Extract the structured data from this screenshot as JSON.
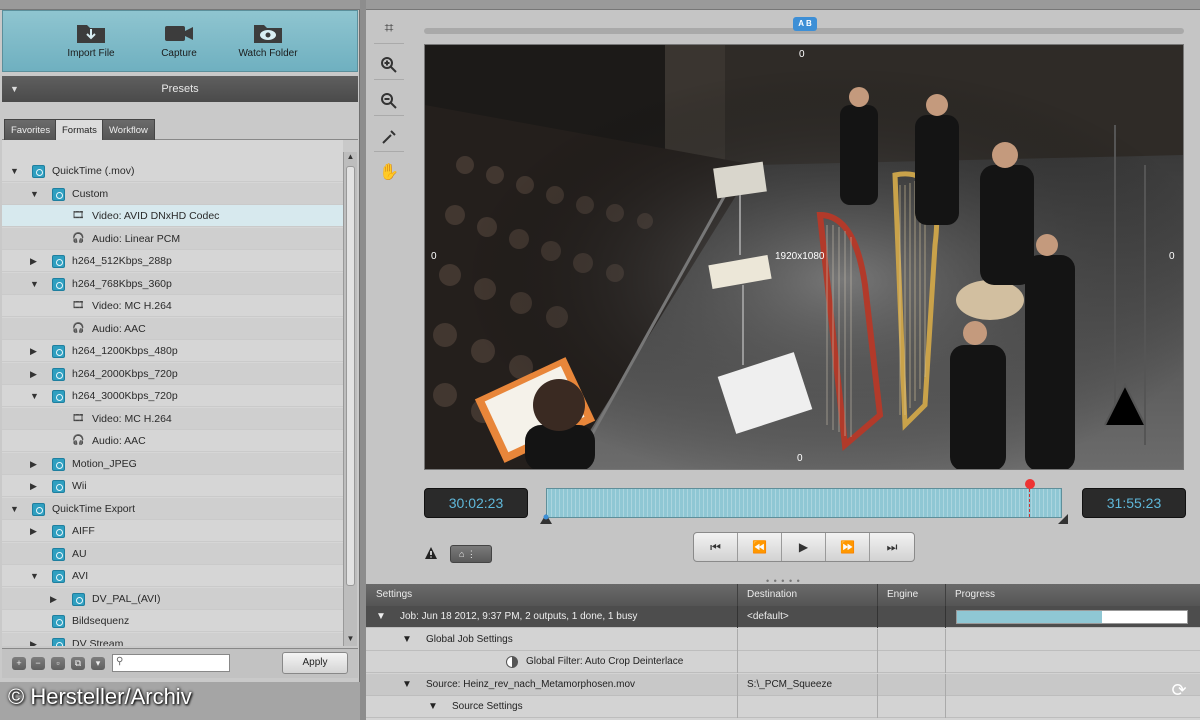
{
  "import_bar": {
    "import_file": "Import File",
    "capture": "Capture",
    "watch_folder": "Watch Folder"
  },
  "presets": {
    "title": "Presets",
    "tabs": [
      "Favorites",
      "Formats",
      "Workflow"
    ],
    "active_tab": "Formats"
  },
  "tree": [
    {
      "label": "QuickTime (.mov)",
      "level": 0,
      "arrow": "down",
      "icon": "folder"
    },
    {
      "label": "Custom",
      "level": 1,
      "arrow": "down",
      "icon": "folder"
    },
    {
      "label": "Video: AVID DNxHD Codec",
      "level": 2,
      "arrow": "",
      "icon": "film",
      "selected": true
    },
    {
      "label": "Audio: Linear PCM",
      "level": 2,
      "arrow": "",
      "icon": "headphones"
    },
    {
      "label": "h264_512Kbps_288p",
      "level": 1,
      "arrow": "right",
      "icon": "folder"
    },
    {
      "label": "h264_768Kbps_360p",
      "level": 1,
      "arrow": "down",
      "icon": "folder"
    },
    {
      "label": "Video: MC H.264",
      "level": 2,
      "arrow": "",
      "icon": "film"
    },
    {
      "label": "Audio: AAC",
      "level": 2,
      "arrow": "",
      "icon": "headphones"
    },
    {
      "label": "h264_1200Kbps_480p",
      "level": 1,
      "arrow": "right",
      "icon": "folder"
    },
    {
      "label": "h264_2000Kbps_720p",
      "level": 1,
      "arrow": "right",
      "icon": "folder"
    },
    {
      "label": "h264_3000Kbps_720p",
      "level": 1,
      "arrow": "down",
      "icon": "folder"
    },
    {
      "label": "Video: MC H.264",
      "level": 2,
      "arrow": "",
      "icon": "film"
    },
    {
      "label": "Audio: AAC",
      "level": 2,
      "arrow": "",
      "icon": "headphones"
    },
    {
      "label": "Motion_JPEG",
      "level": 1,
      "arrow": "right",
      "icon": "folder"
    },
    {
      "label": "Wii",
      "level": 1,
      "arrow": "right",
      "icon": "folder"
    },
    {
      "label": "QuickTime Export",
      "level": 0,
      "arrow": "down",
      "icon": "folder"
    },
    {
      "label": "AIFF",
      "level": 1,
      "arrow": "right",
      "icon": "folder"
    },
    {
      "label": "AU",
      "level": 1,
      "arrow": "",
      "icon": "folder"
    },
    {
      "label": "AVI",
      "level": 1,
      "arrow": "down",
      "icon": "folder"
    },
    {
      "label": "DV_PAL_(AVI)",
      "level": 2,
      "arrow": "right",
      "icon": "folder"
    },
    {
      "label": "Bildsequenz",
      "level": 1,
      "arrow": "",
      "icon": "folder"
    },
    {
      "label": "DV Stream",
      "level": 1,
      "arrow": "right",
      "icon": "folder"
    }
  ],
  "bottom_tools": {
    "search_placeholder": "",
    "apply": "Apply"
  },
  "watermark": "© Hersteller/Archiv",
  "viewer": {
    "crop_top": "0",
    "crop_left": "0",
    "crop_right": "0",
    "crop_bottom": "0",
    "dimensions": "1920x1080",
    "ab_marker": "A B",
    "timecode_in": "30:02:23",
    "timecode_out": "31:55:23",
    "playhead_fraction": 0.94,
    "mini_dropdown": "⌂ ⋮"
  },
  "jobs": {
    "headers": {
      "settings": "Settings",
      "destination": "Destination",
      "engine": "Engine",
      "progress": "Progress"
    },
    "rows": [
      {
        "settings": "Job: Jun 18 2012, 9:37 PM, 2 outputs, 1 done, 1 busy",
        "destination": "<default>",
        "indent": 0,
        "arrow": "▼",
        "style": "dark",
        "progress": 0.63
      },
      {
        "settings": "Global Job Settings",
        "destination": "",
        "indent": 1,
        "arrow": "▼",
        "style": "light"
      },
      {
        "settings": "Global Filter: Auto Crop Deinterlace",
        "destination": "",
        "indent": 2,
        "arrow": "",
        "style": "light",
        "icon": "filter"
      },
      {
        "settings": "Source: Heinz_rev_nach_Metamorphosen.mov",
        "destination": "S:\\_PCM_Squeeze",
        "indent": 1,
        "arrow": "▼",
        "style": "mid"
      },
      {
        "settings": "Source Settings",
        "destination": "",
        "indent": 2,
        "arrow": "▼",
        "style": "light"
      }
    ]
  },
  "colors": {
    "accent_teal": "#8fc7d4",
    "timecode_text": "#5fb7d9",
    "playhead": "#e33333"
  }
}
